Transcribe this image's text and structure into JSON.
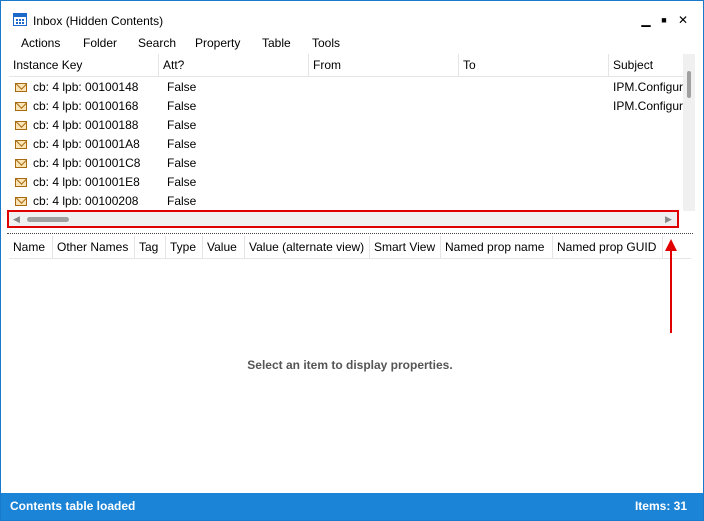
{
  "window": {
    "title": "Inbox (Hidden Contents)",
    "controls": {
      "minimize": "▁",
      "maximize": "■",
      "close": "✕"
    }
  },
  "menu": [
    "Actions",
    "Folder",
    "Search",
    "Property",
    "Table",
    "Tools"
  ],
  "contents_table": {
    "columns": [
      "Instance Key",
      "Att?",
      "From",
      "To",
      "Subject"
    ],
    "rows": [
      {
        "instance_key": "cb: 4 lpb: 00100148",
        "att": "False",
        "from": "",
        "to": "",
        "subject": "IPM.Configuration"
      },
      {
        "instance_key": "cb: 4 lpb: 00100168",
        "att": "False",
        "from": "",
        "to": "",
        "subject": "IPM.Configuration"
      },
      {
        "instance_key": "cb: 4 lpb: 00100188",
        "att": "False",
        "from": "",
        "to": "",
        "subject": ""
      },
      {
        "instance_key": "cb: 4 lpb: 001001A8",
        "att": "False",
        "from": "",
        "to": "",
        "subject": ""
      },
      {
        "instance_key": "cb: 4 lpb: 001001C8",
        "att": "False",
        "from": "",
        "to": "",
        "subject": ""
      },
      {
        "instance_key": "cb: 4 lpb: 001001E8",
        "att": "False",
        "from": "",
        "to": "",
        "subject": ""
      },
      {
        "instance_key": "cb: 4 lpb: 00100208",
        "att": "False",
        "from": "",
        "to": "",
        "subject": ""
      }
    ]
  },
  "properties_table": {
    "columns": [
      "Name",
      "Other Names",
      "Tag",
      "Type",
      "Value",
      "Value (alternate view)",
      "Smart View",
      "Named prop name",
      "Named prop GUID"
    ],
    "empty_message": "Select an item to display properties."
  },
  "status": {
    "left": "Contents table loaded",
    "right": "Items: 31"
  },
  "colors": {
    "status_bar": "#1b84d6",
    "highlight": "#e00000",
    "window_border": "#1979ca"
  }
}
